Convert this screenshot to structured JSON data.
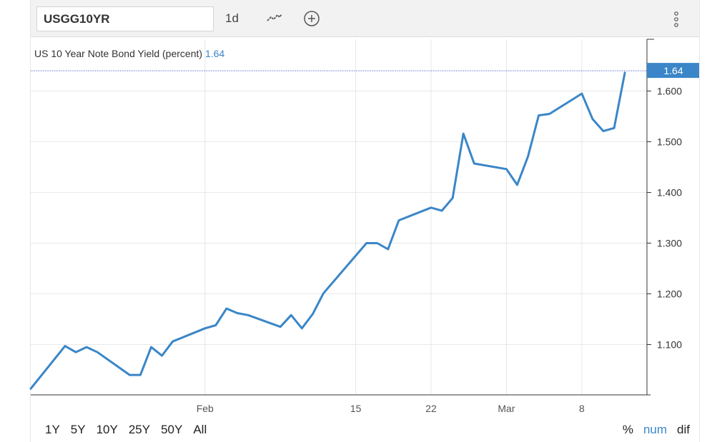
{
  "toolbar": {
    "symbol": "USGG10YR",
    "interval": "1d"
  },
  "legend": {
    "series_label": "US 10 Year Note Bond Yield (percent)",
    "last_value": "1.64"
  },
  "range_buttons": [
    "1Y",
    "5Y",
    "10Y",
    "25Y",
    "50Y",
    "All"
  ],
  "mode_buttons": {
    "percent": "%",
    "num": "num",
    "dif": "dif"
  },
  "colors": {
    "line": "#3a86c8",
    "price_label_bg": "#3a86c8",
    "grid": "#e8e8e8",
    "axis": "#333333"
  },
  "chart_data": {
    "type": "line",
    "series": [
      {
        "name": "US 10 Year Note Bond Yield (percent)",
        "x": [
          "2021-01-19",
          "2021-01-20",
          "2021-01-21",
          "2021-01-22",
          "2021-01-25",
          "2021-01-26",
          "2021-01-27",
          "2021-01-28",
          "2021-01-29",
          "2021-02-01",
          "2021-02-02",
          "2021-02-03",
          "2021-02-04",
          "2021-02-05",
          "2021-02-08",
          "2021-02-09",
          "2021-02-10",
          "2021-02-11",
          "2021-02-12",
          "2021-02-16",
          "2021-02-17",
          "2021-02-18",
          "2021-02-19",
          "2021-02-22",
          "2021-02-23",
          "2021-02-24",
          "2021-02-25",
          "2021-02-26",
          "2021-03-01",
          "2021-03-02",
          "2021-03-03",
          "2021-03-04",
          "2021-03-05",
          "2021-03-08",
          "2021-03-09",
          "2021-03-10",
          "2021-03-11",
          "2021-03-12"
        ],
        "values": [
          1.097,
          1.085,
          1.095,
          1.085,
          1.04,
          1.04,
          1.095,
          1.078,
          1.106,
          1.132,
          1.138,
          1.171,
          1.162,
          1.158,
          1.135,
          1.158,
          1.132,
          1.16,
          1.201,
          1.3,
          1.3,
          1.288,
          1.345,
          1.37,
          1.364,
          1.389,
          1.516,
          1.457,
          1.446,
          1.415,
          1.471,
          1.552,
          1.555,
          1.595,
          1.545,
          1.521,
          1.527,
          1.636
        ]
      }
    ],
    "visible_start_value": 1.013,
    "last_value": 1.64,
    "x_tick_labels": [
      "Feb",
      "15",
      "22",
      "Mar",
      "8",
      "15"
    ],
    "y_tick_labels": [
      "1.100",
      "1.200",
      "1.300",
      "1.400",
      "1.500",
      "1.600"
    ],
    "ylim": [
      1.0,
      1.705
    ],
    "grid": true
  }
}
